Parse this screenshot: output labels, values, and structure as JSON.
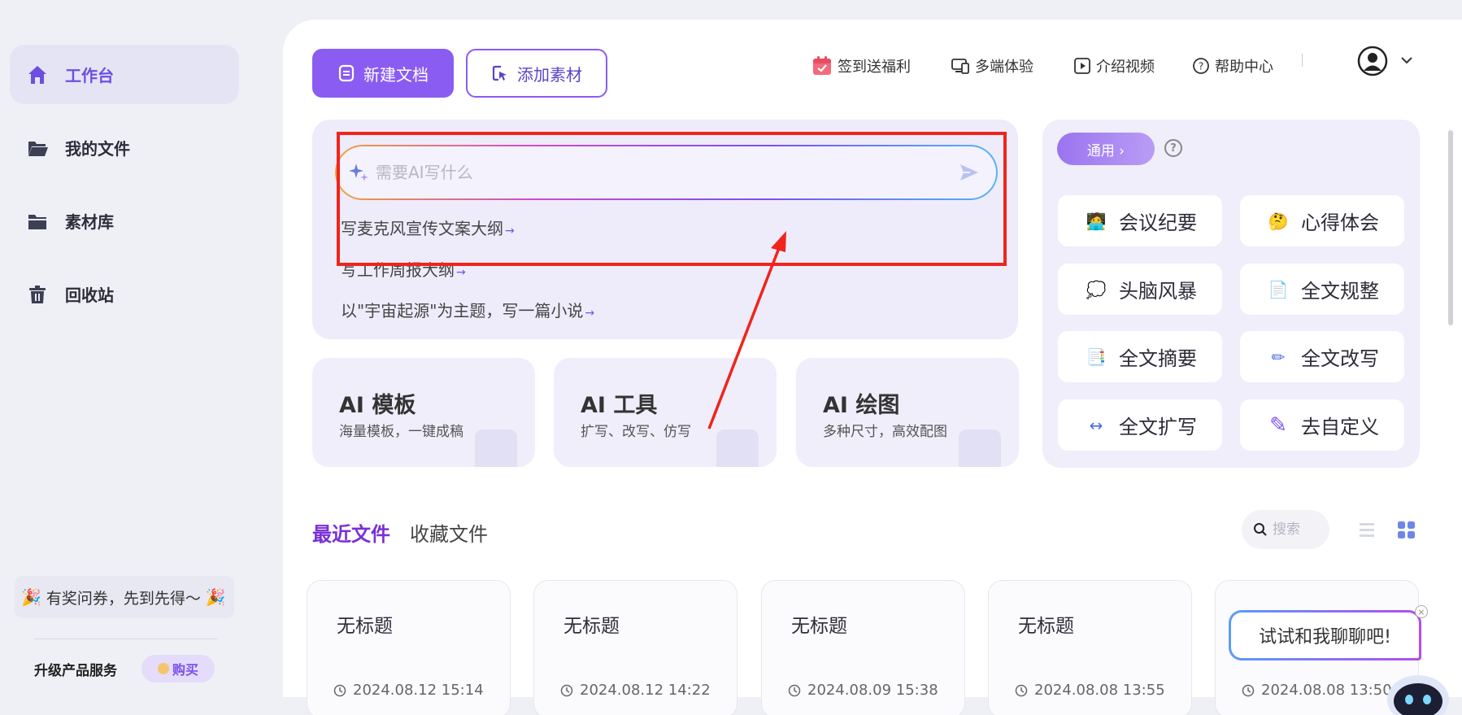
{
  "sidebar": {
    "items": [
      {
        "label": "工作台",
        "icon": "home-icon",
        "active": true
      },
      {
        "label": "我的文件",
        "icon": "folder-open-icon"
      },
      {
        "label": "素材库",
        "icon": "folder-icon"
      },
      {
        "label": "回收站",
        "icon": "trash-icon"
      }
    ],
    "promo": {
      "text": "有奖问券，先到先得～",
      "emoji": "🎉"
    },
    "upgrade_label": "升级产品服务",
    "buy_label": "购买"
  },
  "toolbar": {
    "new_doc_label": "新建文档",
    "add_material_label": "添加素材",
    "links": [
      {
        "label": "签到送福利",
        "icon": "calendar-gift-icon"
      },
      {
        "label": "多端体验",
        "icon": "devices-icon"
      },
      {
        "label": "介绍视频",
        "icon": "play-icon"
      },
      {
        "label": "帮助中心",
        "icon": "help-circle-icon"
      }
    ]
  },
  "prompt": {
    "placeholder": "需要AI写什么",
    "suggestions": [
      "写麦克风宣传文案大纲",
      "写工作周报大纲",
      "以\"宇宙起源\"为主题，写一篇小说"
    ],
    "suggestion_arrow": "→"
  },
  "ai_cards": [
    {
      "title": "AI 模板",
      "subtitle": "海量模板，一键成稿"
    },
    {
      "title": "AI 工具",
      "subtitle": "扩写、改写、仿写"
    },
    {
      "title": "AI 绘图",
      "subtitle": "多种尺寸，高效配图"
    }
  ],
  "quick": {
    "category_label": "通用 ›",
    "help_label": "?",
    "buttons": [
      {
        "label": "会议纪要",
        "icon": "meeting-person-icon",
        "glyph": "🧑‍💻"
      },
      {
        "label": "心得体会",
        "icon": "thinking-face-icon",
        "glyph": "🤔"
      },
      {
        "label": "头脑风暴",
        "icon": "thought-bubble-icon",
        "glyph": "💭"
      },
      {
        "label": "全文规整",
        "icon": "document-sparkle-icon",
        "glyph": "📄"
      },
      {
        "label": "全文摘要",
        "icon": "document-summary-icon",
        "glyph": "📑"
      },
      {
        "label": "全文改写",
        "icon": "rewrite-icon",
        "glyph": "✏"
      },
      {
        "label": "全文扩写",
        "icon": "expand-icon",
        "glyph": "↔"
      },
      {
        "label": "去自定义",
        "icon": "pencil-icon",
        "glyph": "✎"
      }
    ]
  },
  "files": {
    "tabs": [
      {
        "label": "最近文件",
        "active": true
      },
      {
        "label": "收藏文件",
        "active": false
      }
    ],
    "search_placeholder": "搜索",
    "items": [
      {
        "title": "无标题",
        "date": "2024.08.12 15:14"
      },
      {
        "title": "无标题",
        "date": "2024.08.12 14:22"
      },
      {
        "title": "无标题",
        "date": "2024.08.09 15:38"
      },
      {
        "title": "无标题",
        "date": "2024.08.08 13:55"
      },
      {
        "title": "",
        "date": "2024.08.08 13:50"
      }
    ]
  },
  "chat": {
    "label": "试试和我聊聊吧!",
    "close": "×"
  },
  "colors": {
    "accent": "#8a5cf2",
    "annotation": "#f0241c",
    "panel": "#eeecfa"
  }
}
